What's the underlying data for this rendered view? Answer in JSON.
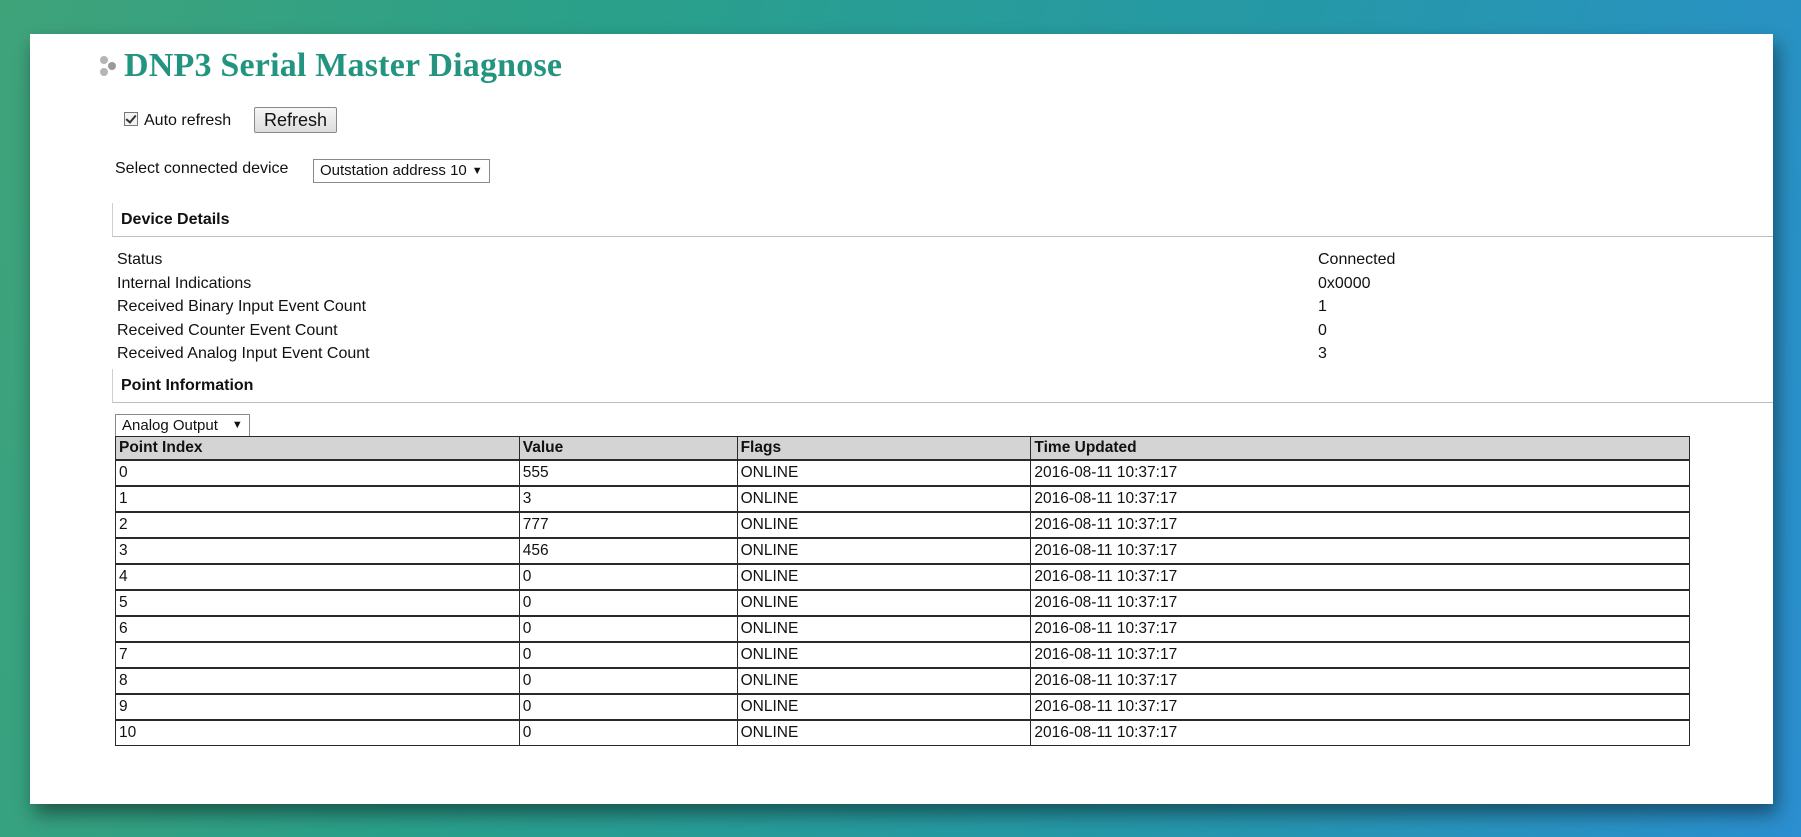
{
  "page": {
    "title": "DNP3 Serial Master Diagnose"
  },
  "controls": {
    "auto_refresh_label": "Auto refresh",
    "auto_refresh_checked": true,
    "refresh_button_label": "Refresh",
    "device_select_label": "Select connected device",
    "device_select_value": "Outstation address 10"
  },
  "device_details": {
    "header": "Device Details",
    "rows": [
      {
        "label": "Status",
        "value": "Connected"
      },
      {
        "label": "Internal Indications",
        "value": "0x0000"
      },
      {
        "label": "Received Binary Input Event Count",
        "value": "1"
      },
      {
        "label": "Received Counter Event Count",
        "value": "0"
      },
      {
        "label": "Received Analog Input Event Count",
        "value": "3"
      }
    ]
  },
  "point_information": {
    "header": "Point Information",
    "type_select_value": "Analog Output",
    "columns": [
      "Point Index",
      "Value",
      "Flags",
      "Time Updated"
    ],
    "rows": [
      [
        "0",
        "555",
        "ONLINE",
        "2016-08-11 10:37:17"
      ],
      [
        "1",
        "3",
        "ONLINE",
        "2016-08-11 10:37:17"
      ],
      [
        "2",
        "777",
        "ONLINE",
        "2016-08-11 10:37:17"
      ],
      [
        "3",
        "456",
        "ONLINE",
        "2016-08-11 10:37:17"
      ],
      [
        "4",
        "0",
        "ONLINE",
        "2016-08-11 10:37:17"
      ],
      [
        "5",
        "0",
        "ONLINE",
        "2016-08-11 10:37:17"
      ],
      [
        "6",
        "0",
        "ONLINE",
        "2016-08-11 10:37:17"
      ],
      [
        "7",
        "0",
        "ONLINE",
        "2016-08-11 10:37:17"
      ],
      [
        "8",
        "0",
        "ONLINE",
        "2016-08-11 10:37:17"
      ],
      [
        "9",
        "0",
        "ONLINE",
        "2016-08-11 10:37:17"
      ],
      [
        "10",
        "0",
        "ONLINE",
        "2016-08-11 10:37:17"
      ]
    ]
  },
  "colors": {
    "title": "#23947f",
    "table_header_bg": "#d4d4d4"
  },
  "icons": {
    "title_icon": "dots-icon",
    "select_caret": "caret-down-icon",
    "checkbox": "checkmark-icon"
  }
}
